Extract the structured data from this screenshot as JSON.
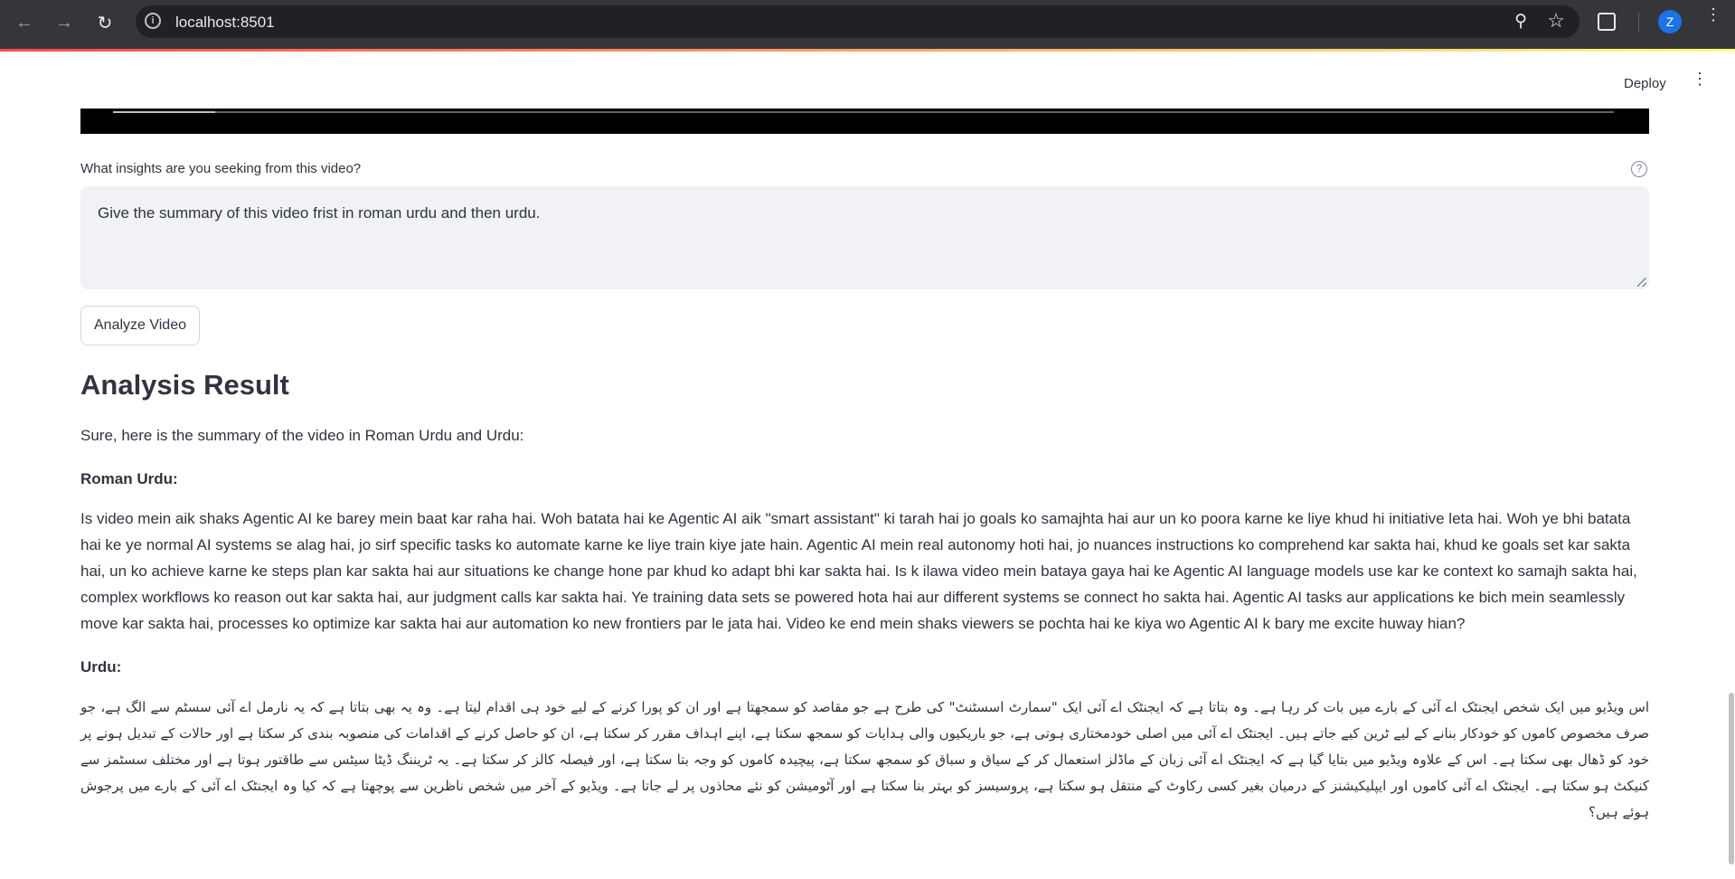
{
  "browser": {
    "url": "localhost:8501",
    "profile_initial": "Z"
  },
  "header": {
    "deploy_label": "Deploy"
  },
  "form": {
    "question_label": "What insights are you seeking from this video?",
    "question_value": "Give the summary of this video frist in roman urdu and then urdu.",
    "analyze_label": "Analyze Video"
  },
  "result": {
    "title": "Analysis Result",
    "intro": "Sure, here is the summary of the video in Roman Urdu and Urdu:",
    "roman_heading": "Roman Urdu:",
    "roman_text": "Is video mein aik shaks Agentic AI ke barey mein baat kar raha hai. Woh batata hai ke Agentic AI aik \"smart assistant\" ki tarah hai jo goals ko samajhta hai aur un ko poora karne ke liye khud hi initiative leta hai. Woh ye bhi batata hai ke ye normal AI systems se alag hai, jo sirf specific tasks ko automate karne ke liye train kiye jate hain. Agentic AI mein real autonomy hoti hai, jo nuances instructions ko comprehend kar sakta hai, khud ke goals set kar sakta hai, un ko achieve karne ke steps plan kar sakta hai aur situations ke change hone par khud ko adapt bhi kar sakta hai. Is k ilawa video mein bataya gaya hai ke Agentic AI language models use kar ke context ko samajh sakta hai, complex workflows ko reason out kar sakta hai, aur judgment calls kar sakta hai. Ye training data sets se powered hota hai aur different systems se connect ho sakta hai. Agentic AI tasks aur applications ke bich mein seamlessly move kar sakta hai, processes ko optimize kar sakta hai aur automation ko new frontiers par le jata hai. Video ke end mein shaks viewers se pochta hai ke kiya wo Agentic AI k bary me excite huway hian?",
    "urdu_heading": "Urdu:",
    "urdu_text": "اس ویڈیو میں ایک شخص ایجنٹک اے آئی کے بارے میں بات کر رہا ہے۔ وہ بتاتا ہے کہ ایجنٹک اے آئی ایک \"سمارٹ اسسٹنٹ\" کی طرح ہے جو مقاصد کو سمجھتا ہے اور ان کو پورا کرنے کے لیے خود ہی اقدام لیتا ہے۔ وہ یہ بھی بتاتا ہے کہ یہ نارمل اے آئی سسٹم سے الگ ہے، جو صرف مخصوص کاموں کو خودکار بنانے کے لیے ٹرین کیے جاتے ہیں۔ ایجنٹک اے آئی میں اصلی خودمختاری ہوتی ہے، جو باریکیوں والی ہدایات کو سمجھ سکتا ہے، اپنے اہداف مقرر کر سکتا ہے، ان کو حاصل کرنے کے اقدامات کی منصوبہ بندی کر سکتا ہے اور حالات کے تبدیل ہونے پر خود کو ڈھال بھی سکتا ہے۔ اس کے علاوہ ویڈیو میں بتایا گیا ہے کہ ایجنٹک اے آئی زبان کے ماڈلز استعمال کر کے سیاق و سباق کو سمجھ سکتا ہے، پیچیدہ کاموں کو وجہ بتا سکتا ہے، اور فیصلہ کالز کر سکتا ہے۔ یہ ٹریننگ ڈیٹا سیٹس سے طاقتور ہوتا ہے اور مختلف سسٹمز سے کنیکٹ ہو سکتا ہے۔ ایجنٹک اے آئی کاموں اور ایپلیکیشنز کے درمیان بغیر کسی رکاوٹ کے منتقل ہو سکتا ہے، پروسیسز کو بہتر بنا سکتا ہے اور آٹومیشن کو نئے محاذوں پر لے جاتا ہے۔ ویڈیو کے آخر میں شخص ناظرین سے پوچھتا ہے کہ کیا وہ ایجنٹک اے آئی کے بارے میں پرجوش ہوئے ہیں؟"
  },
  "colors": {
    "chrome_bg": "#35363a",
    "omnibox_bg": "#202124",
    "text": "#31333f",
    "input_bg": "#f0f2f6",
    "accent": "#ff4b4b"
  },
  "icons": [
    "back-arrow-icon",
    "forward-arrow-icon",
    "reload-icon",
    "site-info-icon",
    "zoom-icon",
    "star-icon",
    "extensions-icon",
    "chrome-menu-icon",
    "app-menu-icon",
    "help-icon"
  ]
}
